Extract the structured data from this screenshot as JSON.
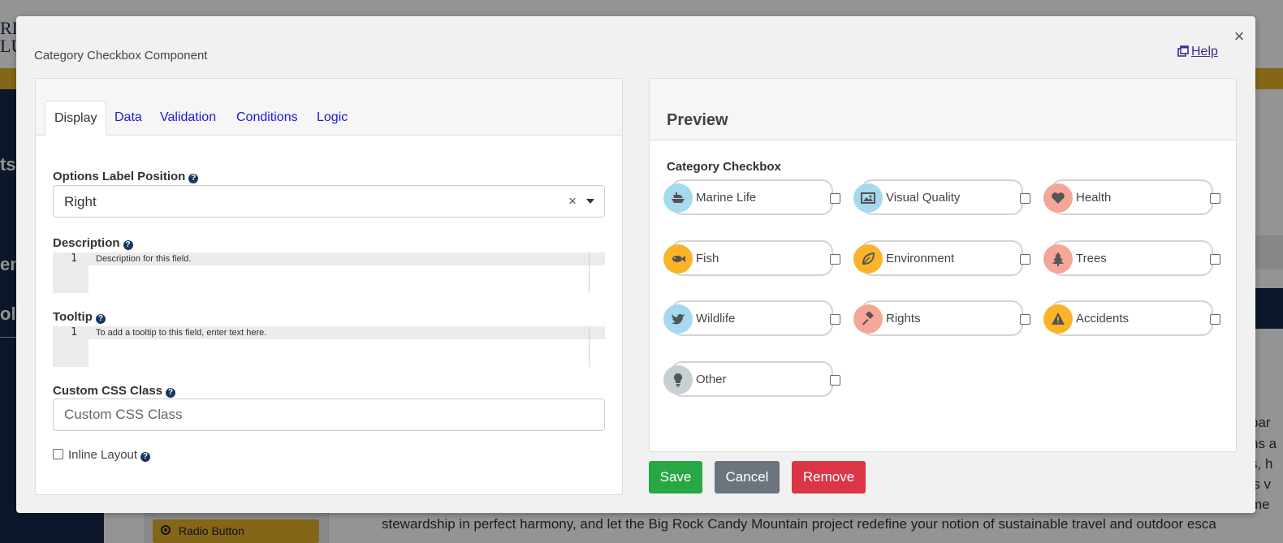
{
  "background": {
    "logo_lines": [
      "RIT",
      "LU"
    ],
    "sidebar_fragments": [
      "ts",
      "en",
      "ol"
    ],
    "radio_button_label": "Radio Button",
    "body_text": "stewardship in perfect harmony, and let the Big Rock Candy Mountain project redefine your notion of sustainable travel and outdoor esca",
    "right_text_fragments": [
      "bar",
      "ns a",
      "s, h",
      "'s v",
      "me"
    ]
  },
  "modal": {
    "title": "Category Checkbox Component",
    "close_glyph": "×",
    "help_label": "Help"
  },
  "tabs": [
    {
      "label": "Display",
      "active": true
    },
    {
      "label": "Data",
      "active": false
    },
    {
      "label": "Validation",
      "active": false
    },
    {
      "label": "Conditions",
      "active": false
    },
    {
      "label": "Logic",
      "active": false
    }
  ],
  "form": {
    "options_label_position": {
      "label": "Options Label Position",
      "value": "Right",
      "clear_glyph": "×"
    },
    "description": {
      "label": "Description",
      "line_number": "1",
      "placeholder_text": "Description for this field."
    },
    "tooltip": {
      "label": "Tooltip",
      "line_number": "1",
      "placeholder_text": "To add a tooltip to this field, enter text here."
    },
    "custom_css": {
      "label": "Custom CSS Class",
      "placeholder": "Custom CSS Class"
    },
    "inline_layout": {
      "label": "Inline Layout",
      "checked": false
    },
    "help_glyph": "?"
  },
  "preview": {
    "title": "Preview",
    "component_label": "Category Checkbox",
    "options": [
      {
        "label": "Marine Life",
        "icon": "ship-icon",
        "color": "#a4d9ef",
        "checked": false
      },
      {
        "label": "Visual Quality",
        "icon": "image-icon",
        "color": "#a4d9ef",
        "checked": false
      },
      {
        "label": "Health",
        "icon": "heart-icon",
        "color": "#f4a797",
        "checked": false
      },
      {
        "label": "Fish",
        "icon": "fish-icon",
        "color": "#fbb32a",
        "checked": false
      },
      {
        "label": "Environment",
        "icon": "leaf-icon",
        "color": "#fbb32a",
        "checked": false
      },
      {
        "label": "Trees",
        "icon": "tree-icon",
        "color": "#f4a797",
        "checked": false
      },
      {
        "label": "Wildlife",
        "icon": "bird-icon",
        "color": "#a4d9ef",
        "checked": false
      },
      {
        "label": "Rights",
        "icon": "gavel-icon",
        "color": "#f4a797",
        "checked": false
      },
      {
        "label": "Accidents",
        "icon": "warning-icon",
        "color": "#fbb32a",
        "checked": false
      },
      {
        "label": "Other",
        "icon": "lightbulb-icon",
        "color": "#c6cfd1",
        "checked": false
      }
    ]
  },
  "buttons": {
    "save": "Save",
    "cancel": "Cancel",
    "remove": "Remove"
  },
  "colors": {
    "save": "#28a745",
    "cancel": "#6c757d",
    "remove": "#dc3545",
    "tab_link": "#1a1adb",
    "help_link": "#3d2d93",
    "sidebar": "#16284a",
    "gold": "#e3b02a"
  }
}
